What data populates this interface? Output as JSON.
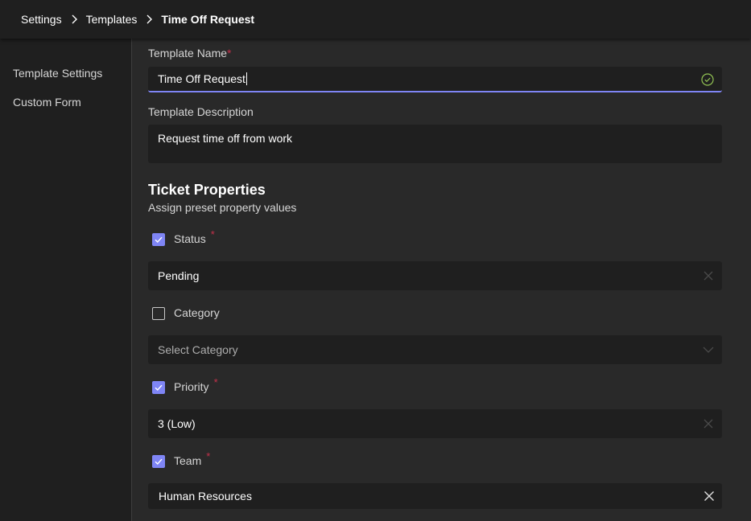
{
  "breadcrumb": {
    "items": [
      "Settings",
      "Templates",
      "Time Off Request"
    ]
  },
  "sidebar": {
    "items": [
      {
        "label": "Template Settings"
      },
      {
        "label": "Custom Form"
      }
    ]
  },
  "form": {
    "template_name_label": "Template Name",
    "required_mark": "*",
    "template_name_value": "Time Off Request",
    "template_description_label": "Template Description",
    "template_description_value": "Request time off from work"
  },
  "ticket_properties": {
    "title": "Ticket Properties",
    "subtitle": "Assign preset property values",
    "properties": [
      {
        "label": "Status",
        "checked": true,
        "required": true,
        "value": "Pending",
        "control": "clearable"
      },
      {
        "label": "Category",
        "checked": false,
        "required": false,
        "placeholder": "Select Category",
        "control": "dropdown"
      },
      {
        "label": "Priority",
        "checked": true,
        "required": true,
        "value": "3 (Low)",
        "control": "clearable"
      },
      {
        "label": "Team",
        "checked": true,
        "required": true,
        "value": "Human Resources",
        "control": "clearable"
      }
    ]
  },
  "colors": {
    "accent": "#7f85f5",
    "required": "#c4314b",
    "success": "#92c353",
    "background": "#292929",
    "panel": "#1f1f1f"
  },
  "icons": {
    "separator": "chevron-right-icon",
    "valid": "check-circle-icon",
    "clear": "close-icon",
    "dropdown": "chevron-down-icon",
    "checkbox": "checkmark-icon"
  }
}
